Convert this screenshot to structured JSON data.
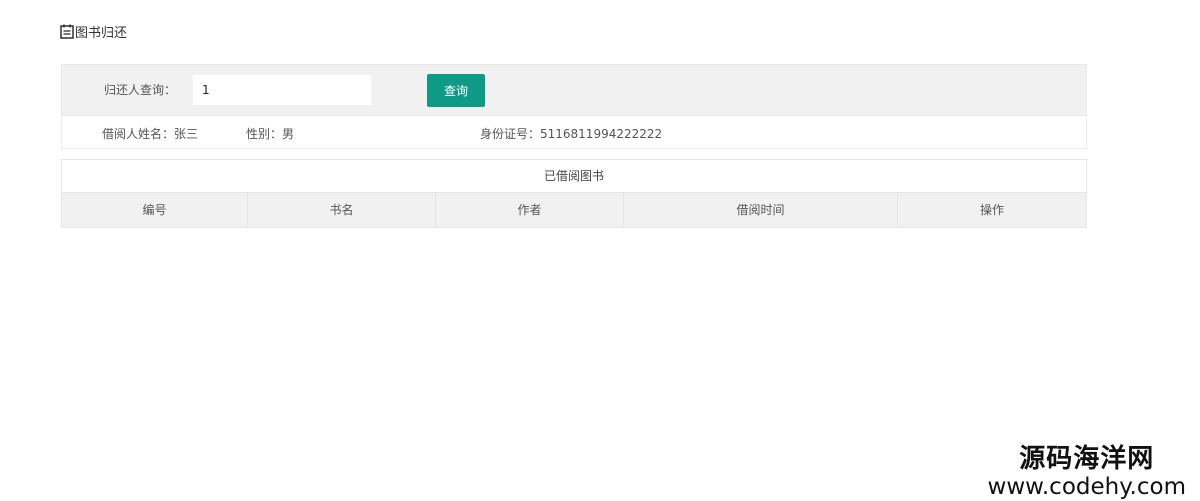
{
  "page": {
    "title": "图书归还",
    "title_icon": "notepad-icon"
  },
  "search": {
    "label": "归还人查询：",
    "value": "1",
    "button_label": "查询"
  },
  "borrower": {
    "name_text": "借阅人姓名：张三",
    "gender_text": "性别：男",
    "id_text": "身份证号：5116811994222222"
  },
  "borrowed": {
    "title": "已借阅图书",
    "columns": [
      "编号",
      "书名",
      "作者",
      "借阅时间",
      "操作"
    ],
    "rows": []
  },
  "watermark": {
    "cn": "源码海洋网",
    "url": "www.codehy.com"
  },
  "colors": {
    "accent": "#0e9b85",
    "panel_bg": "#f1f1f1",
    "border": "#e6e6e6"
  }
}
